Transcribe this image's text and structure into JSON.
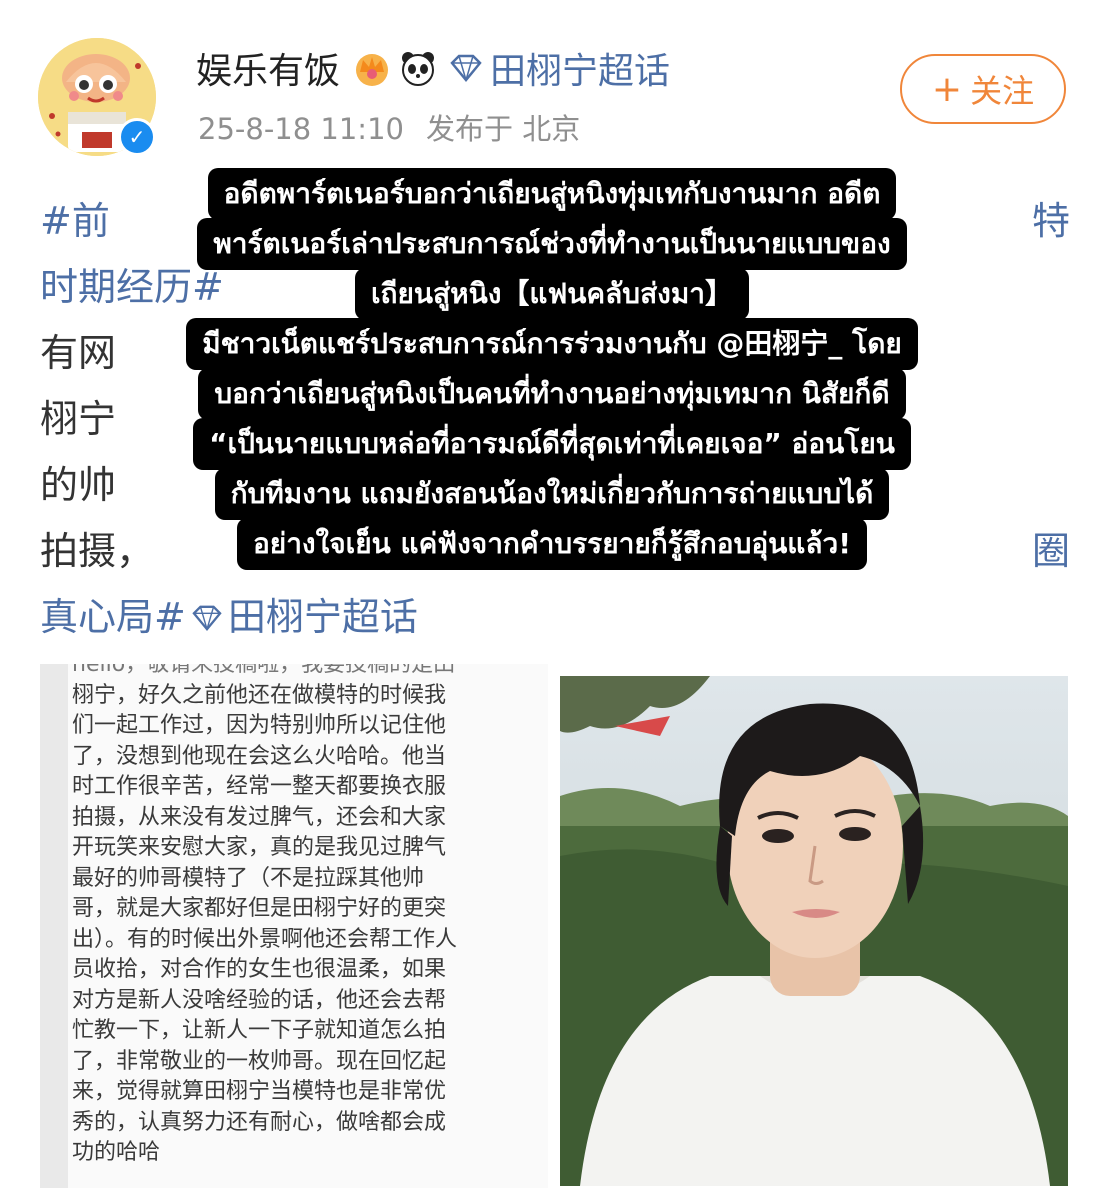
{
  "post": {
    "username": "娱乐有饭",
    "topic_link": "田栩宁超话",
    "date": "25-8-18 11:10",
    "location": "发布于 北京",
    "follow_label": "关注",
    "follow_plus": "+",
    "verified_mark": "✓"
  },
  "post_text": {
    "line1": "#前",
    "line1_end": "特",
    "line2": "时期经历#",
    "line3": "有网",
    "line4": "栩宁",
    "line5": "的帅",
    "line6": "拍摄，",
    "line6_end": "圈",
    "line7": "真心局#",
    "line7_topic": "田栩宁超话"
  },
  "caption": {
    "line1": "อดีตพาร์ตเนอร์บอกว่าเถียนสู่หนิงทุ่มเทกับงานมาก อดีต",
    "line2": "พาร์ตเนอร์เล่าประสบการณ์ช่วงที่ทำงานเป็นนายแบบของ",
    "line3": "เถียนสู่หนิง【แฟนคลับส่งมา】",
    "line4": "มีชาวเน็ตแชร์ประสบการณ์การร่วมงานกับ @田栩宁_ โดย",
    "line5": "บอกว่าเถียนสู่หนิงเป็นคนที่ทำงานอย่างทุ่มเทมาก นิสัยก็ดี",
    "line6": "“เป็นนายแบบหล่อที่อารมณ์ดีที่สุดเท่าที่เคยเจอ” อ่อนโยน",
    "line7": "กับทีมงาน แถมยังสอนน้องใหม่เกี่ยวกับการถ่ายแบบได้",
    "line8": "อย่างใจเย็น แค่ฟังจากคำบรรยายก็รู้สึกอบอุ่นแล้ว!"
  },
  "screenshot_text": {
    "lines": [
      "hello，敬请来投稿啦，我要投稿的是田",
      "栩宁，好久之前他还在做模特的时候我",
      "们一起工作过，因为特别帅所以记住他",
      "了，没想到他现在会这么火哈哈。他当",
      "时工作很辛苦，经常一整天都要换衣服",
      "拍摄，从来没有发过脾气，还会和大家",
      "开玩笑来安慰大家，真的是我见过脾气",
      "最好的帅哥模特了（不是拉踩其他帅",
      "哥，就是大家都好但是田栩宁好的更突",
      "出）。有的时候出外景啊他还会帮工作人",
      "员收拾，对合作的女生也很温柔，如果",
      "对方是新人没啥经验的话，他还会去帮",
      "忙教一下，让新人一下子就知道怎么拍",
      "了，非常敬业的一枚帅哥。现在回忆起",
      "来，觉得就算田栩宁当模特也是非常优",
      "秀的，认真努力还有耐心，做啥都会成",
      "功的哈哈"
    ]
  },
  "colors": {
    "link": "#4d6fa6",
    "follow": "#f0863a",
    "meta": "#8f8f8f",
    "verified": "#1a8cf0"
  },
  "icons": {
    "avatar": "cartoon-avatar",
    "crown": "crown-icon",
    "panda": "panda-icon",
    "diamond": "diamond-icon",
    "verified": "verified-icon"
  }
}
